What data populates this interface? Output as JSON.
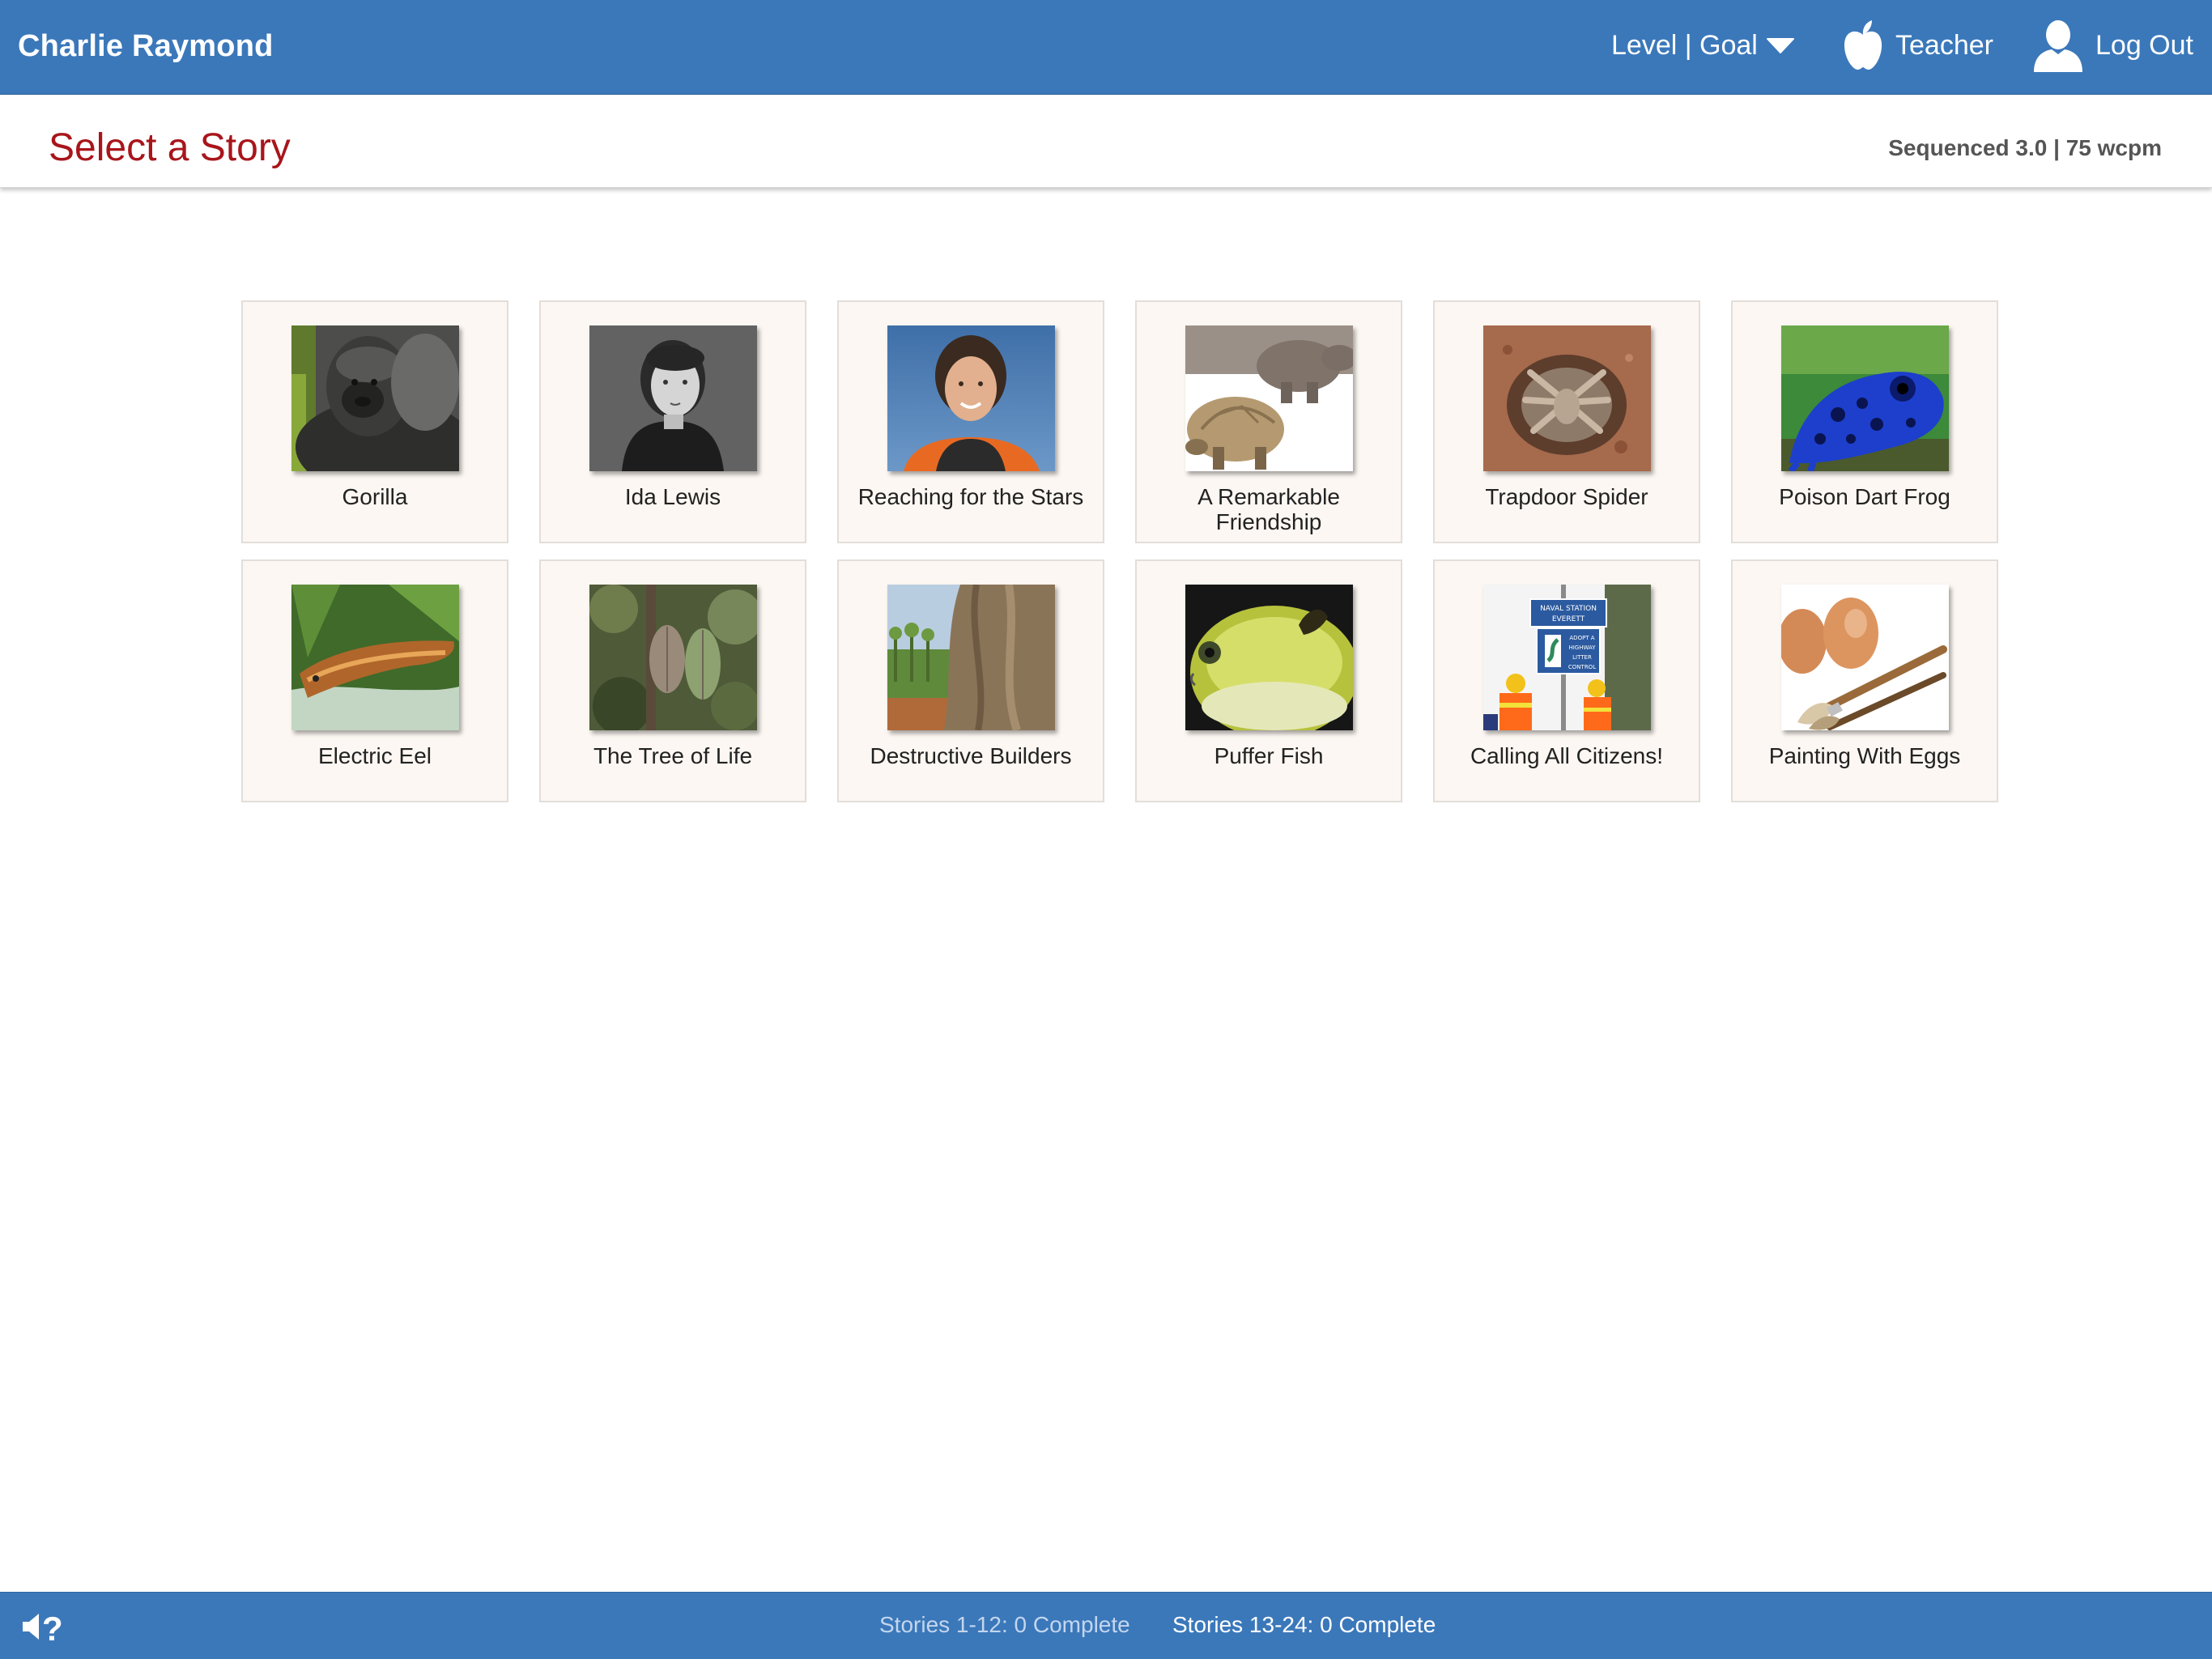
{
  "topbar": {
    "user_name": "Charlie Raymond",
    "level_goal_label": "Level | Goal",
    "teacher_label": "Teacher",
    "logout_label": "Log Out"
  },
  "header": {
    "title": "Select a Story",
    "level_info": "Sequenced 3.0 | 75 wcpm"
  },
  "stories": [
    {
      "title": "Gorilla",
      "icon": "gorilla-image"
    },
    {
      "title": "Ida Lewis",
      "icon": "ida-lewis-portrait-image"
    },
    {
      "title": "Reaching for the Stars",
      "icon": "astronaut-portrait-image"
    },
    {
      "title": "A Remarkable Friendship",
      "icon": "hippo-and-tortoise-image"
    },
    {
      "title": "Trapdoor Spider",
      "icon": "trapdoor-spider-image"
    },
    {
      "title": "Poison Dart Frog",
      "icon": "blue-frog-image"
    },
    {
      "title": "Electric Eel",
      "icon": "electric-eel-image"
    },
    {
      "title": "The Tree of Life",
      "icon": "cacao-tree-image"
    },
    {
      "title": "Destructive Builders",
      "icon": "termite-mound-image"
    },
    {
      "title": "Puffer Fish",
      "icon": "puffer-fish-image"
    },
    {
      "title": "Calling All Citizens!",
      "icon": "highway-cleanup-image",
      "sign_text": [
        "NAVAL STATION",
        "EVERETT",
        "ADOPT A",
        "HIGHWAY",
        "LITTER",
        "CONTROL"
      ]
    },
    {
      "title": "Painting With Eggs",
      "icon": "eggs-and-brushes-image"
    }
  ],
  "footer": {
    "progress_1": "Stories 1-12: 0 Complete",
    "progress_2": "Stories 13-24: 0 Complete",
    "help_icon": "audio-help-icon"
  },
  "colors": {
    "bar_blue": "#3b78ba",
    "title_red": "#a8151b",
    "card_bg": "#fcf7f2"
  }
}
